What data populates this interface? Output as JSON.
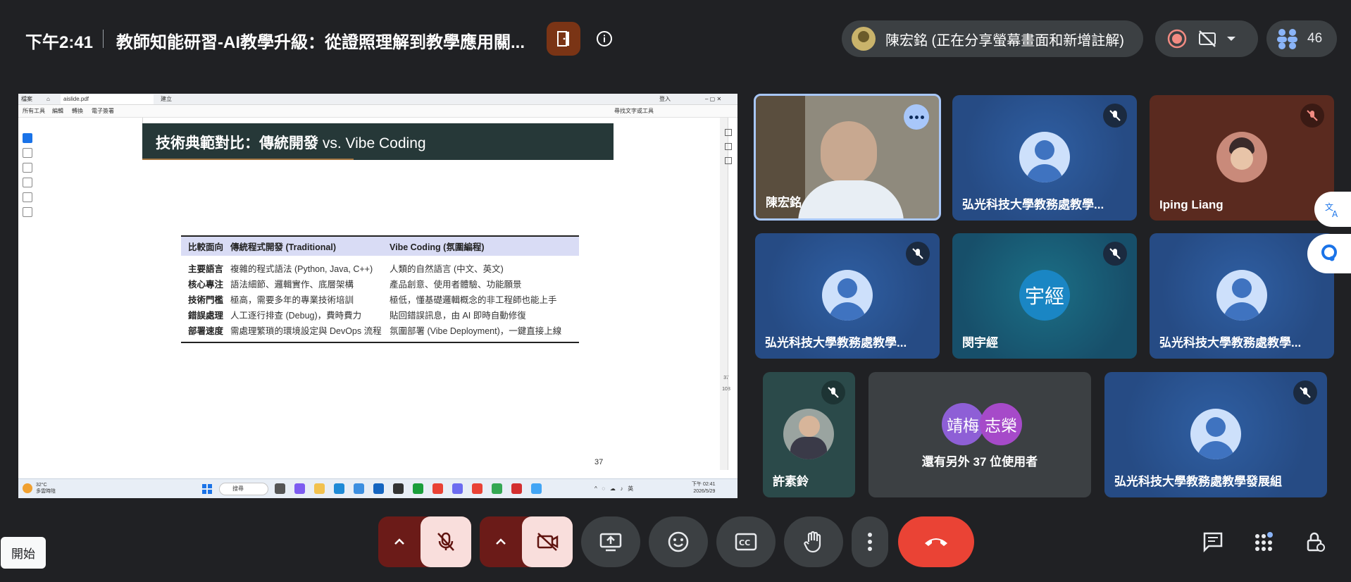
{
  "topbar": {
    "time": "下午2:41",
    "meeting_title": "教師知能研習-AI教學升級：從證照理解到教學應用關...",
    "presenter_text": "陳宏銘 (正在分享螢幕畫面和新增註解)",
    "participant_count": "46"
  },
  "screen": {
    "tabs": {
      "menu": "檔案",
      "file": "aislide.pdf",
      "new_tab": "建立",
      "login": "登入"
    },
    "toolbar": {
      "all_tools": "所有工具",
      "edit": "編輯",
      "convert": "轉換",
      "esign": "電子簽署",
      "find_text": "尋找文字或工具"
    },
    "side_page_num": "37",
    "side_page_total": "108",
    "slide": {
      "title_zh": "技術典範對比：傳統開發",
      "title_en": "vs. Vibe Coding",
      "table": {
        "headers": [
          "比較面向",
          "傳統程式開發 (Traditional)",
          "Vibe Coding (氛圍編程)"
        ],
        "rows": [
          {
            "aspect": "主要語言",
            "traditional": "複雜的程式語法 (Python, Java, C++)",
            "vibe": "人類的自然語言 (中文、英文)"
          },
          {
            "aspect": "核心專注",
            "traditional": "語法細節、邏輯實作、底層架構",
            "vibe": "產品創意、使用者體驗、功能願景"
          },
          {
            "aspect": "技術門檻",
            "traditional": "極高，需要多年的專業技術培訓",
            "vibe": "極低，懂基礎邏輯概念的非工程師也能上手"
          },
          {
            "aspect": "錯誤處理",
            "traditional": "人工逐行排查 (Debug)，費時費力",
            "vibe": "貼回錯誤訊息，由 AI 即時自動修復"
          },
          {
            "aspect": "部署速度",
            "traditional": "需處理繁瑣的環境設定與 DevOps 流程",
            "vibe": "氛圍部署 (Vibe Deployment)，一鍵直接上線"
          }
        ]
      },
      "page_number": "37"
    },
    "taskbar": {
      "weather_temp": "32°C",
      "weather_desc": "多雲時陰",
      "search": "搜尋",
      "tray_lang": "英",
      "clock_time": "下午 02:41",
      "clock_date": "2026/5/29"
    }
  },
  "tiles": [
    {
      "name": "陳宏銘"
    },
    {
      "name": "弘光科技大學教務處教學..."
    },
    {
      "name": "Iping Liang"
    },
    {
      "name": "弘光科技大學教務處教學..."
    },
    {
      "name": "閔宇經",
      "initials": "宇經"
    },
    {
      "name": "弘光科技大學教務處教學..."
    },
    {
      "name": "許素鈴"
    },
    {
      "others_text": "還有另外 37 位使用者",
      "initials_a": "靖梅",
      "initials_b": "志榮"
    },
    {
      "name": "弘光科技大學教務處教學發展組"
    }
  ],
  "controls": {
    "start_label": "開始"
  },
  "colors": {
    "background": "#202124",
    "leave_red": "#ea4335",
    "mic_off_bg": "#f9dedc",
    "chevron_bg": "#6b1b18",
    "tile_blue": "#2a4f86"
  }
}
